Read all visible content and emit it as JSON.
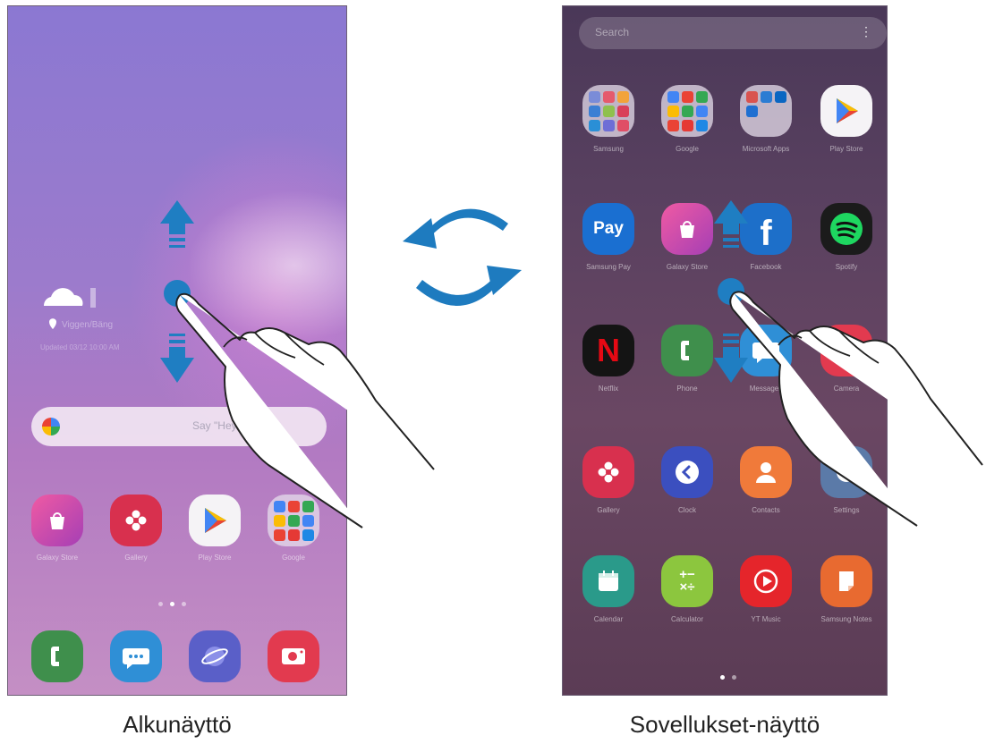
{
  "captions": {
    "home": "Alkunäyttö",
    "apps": "Sovellukset-näyttö"
  },
  "home": {
    "weather_location": "Viggen/Bäng",
    "weather_updated": "Updated 03/12 10:00 AM",
    "google_search_placeholder": "Say \"Hey Google\"",
    "apps": [
      {
        "label": "Galaxy Store",
        "icon": "galaxy-store-icon"
      },
      {
        "label": "Gallery",
        "icon": "gallery-icon"
      },
      {
        "label": "Play Store",
        "icon": "play-store-icon"
      },
      {
        "label": "Google",
        "icon": "google-folder-icon"
      }
    ],
    "dock": [
      {
        "icon": "phone-icon"
      },
      {
        "icon": "messages-icon"
      },
      {
        "icon": "internet-icon"
      },
      {
        "icon": "camera-icon"
      }
    ]
  },
  "apps_screen": {
    "search_placeholder": "Search",
    "rows": [
      [
        {
          "label": "Samsung",
          "icon": "samsung-folder-icon"
        },
        {
          "label": "Google",
          "icon": "google-folder-icon"
        },
        {
          "label": "Microsoft Apps",
          "icon": "microsoft-folder-icon"
        },
        {
          "label": "Play Store",
          "icon": "play-store-icon"
        }
      ],
      [
        {
          "label": "Samsung Pay",
          "icon": "samsung-pay-icon",
          "text": "Pay"
        },
        {
          "label": "Galaxy Store",
          "icon": "galaxy-store-icon"
        },
        {
          "label": "Facebook",
          "icon": "facebook-icon",
          "text": "f"
        },
        {
          "label": "Spotify",
          "icon": "spotify-icon"
        }
      ],
      [
        {
          "label": "Netflix",
          "icon": "netflix-icon",
          "text": "N"
        },
        {
          "label": "Phone",
          "icon": "phone-icon"
        },
        {
          "label": "Messages",
          "icon": "messages-icon"
        },
        {
          "label": "Camera",
          "icon": "camera-icon"
        }
      ],
      [
        {
          "label": "Gallery",
          "icon": "gallery-icon"
        },
        {
          "label": "Clock",
          "icon": "clock-icon"
        },
        {
          "label": "Contacts",
          "icon": "contacts-icon"
        },
        {
          "label": "Settings",
          "icon": "settings-icon"
        }
      ],
      [
        {
          "label": "Calendar",
          "icon": "calendar-icon"
        },
        {
          "label": "Calculator",
          "icon": "calculator-icon",
          "text": "+−\n×÷"
        },
        {
          "label": "YT Music",
          "icon": "yt-music-icon"
        },
        {
          "label": "Samsung Notes",
          "icon": "samsung-notes-icon"
        }
      ]
    ]
  },
  "colors": {
    "arrow_blue": "#1f7ec2",
    "cycle_blue": "#1e7bbf"
  }
}
